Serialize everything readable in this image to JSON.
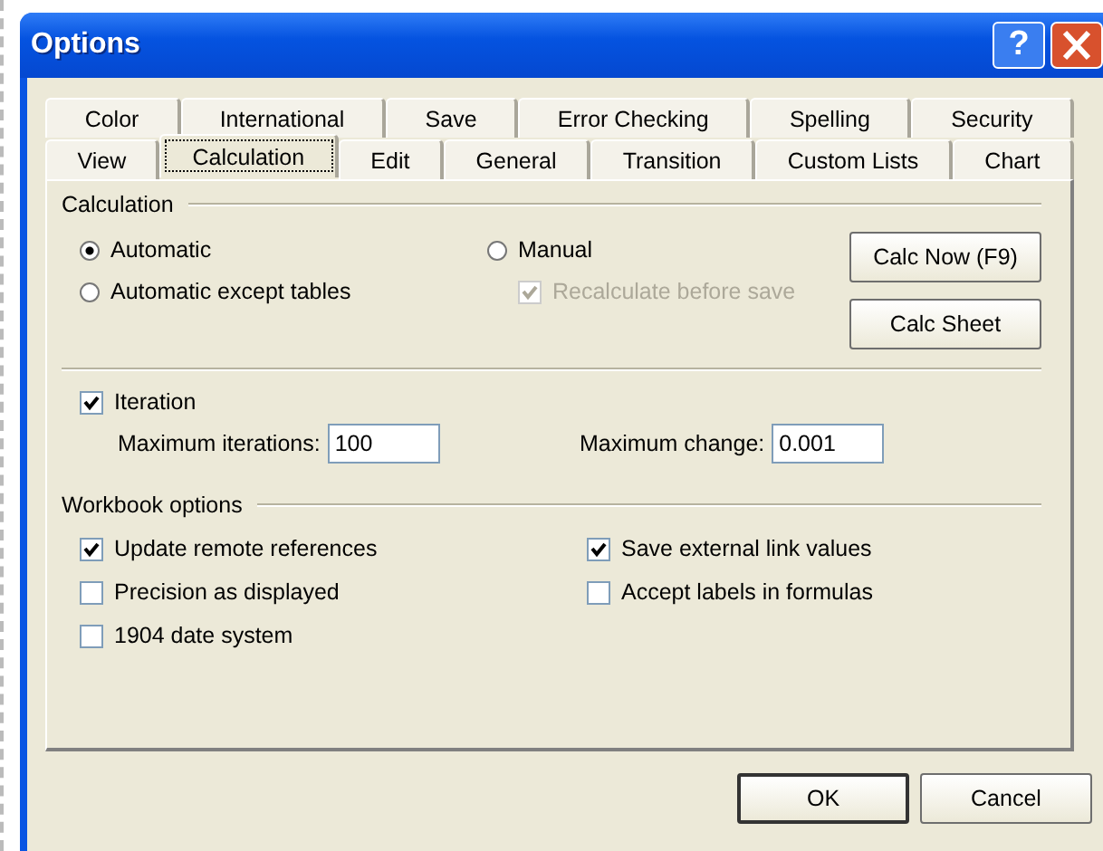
{
  "window": {
    "title": "Options",
    "help_button": "?"
  },
  "tab_rows": [
    [
      {
        "label": "Color",
        "selected": false
      },
      {
        "label": "International",
        "selected": false
      },
      {
        "label": "Save",
        "selected": false
      },
      {
        "label": "Error Checking",
        "selected": false
      },
      {
        "label": "Spelling",
        "selected": false
      },
      {
        "label": "Security",
        "selected": false
      }
    ],
    [
      {
        "label": "View",
        "selected": false
      },
      {
        "label": "Calculation",
        "selected": true
      },
      {
        "label": "Edit",
        "selected": false
      },
      {
        "label": "General",
        "selected": false
      },
      {
        "label": "Transition",
        "selected": false
      },
      {
        "label": "Custom Lists",
        "selected": false
      },
      {
        "label": "Chart",
        "selected": false
      }
    ]
  ],
  "calculation": {
    "heading": "Calculation",
    "modes": [
      {
        "label": "Automatic",
        "selected": true
      },
      {
        "label": "Automatic except tables",
        "selected": false
      },
      {
        "label": "Manual",
        "selected": false
      }
    ],
    "recalculate": {
      "label": "Recalculate before save",
      "checked": true,
      "disabled": true
    },
    "buttons": [
      "Calc Now (F9)",
      "Calc Sheet"
    ],
    "iteration": {
      "label": "Iteration",
      "checked": true
    },
    "fields": [
      {
        "label": "Maximum iterations:",
        "value": "100"
      },
      {
        "label": "Maximum change:",
        "value": "0.001"
      }
    ]
  },
  "workbook": {
    "heading": "Workbook options",
    "options": [
      {
        "label": "Update remote references",
        "checked": true
      },
      {
        "label": "Save external link values",
        "checked": true
      },
      {
        "label": "Precision as displayed",
        "checked": false
      },
      {
        "label": "Accept labels in formulas",
        "checked": false
      },
      {
        "label": "1904 date system",
        "checked": false
      }
    ]
  },
  "buttons": [
    "OK",
    "Cancel"
  ]
}
